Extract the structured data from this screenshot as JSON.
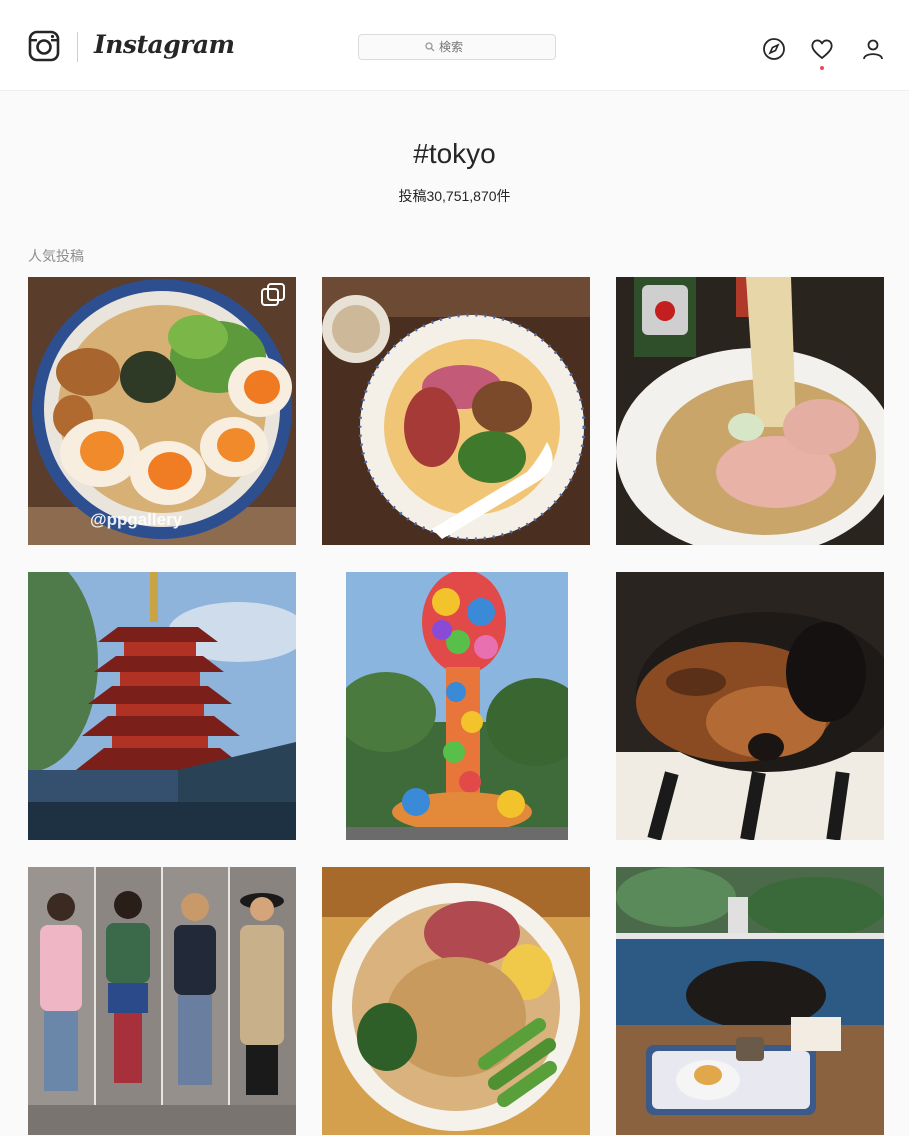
{
  "header": {
    "wordmark": "Instagram",
    "search_placeholder": "検索",
    "icons": [
      "instagram-camera-icon",
      "compass-icon",
      "heart-icon",
      "person-icon"
    ]
  },
  "hashtag": {
    "title": "#tokyo",
    "post_count": "投稿30,751,870件"
  },
  "section": {
    "label": "人気投稿"
  },
  "posts": [
    {
      "subject": "ramen-with-eggs",
      "watermark": "@ppgallery",
      "multi": true
    },
    {
      "subject": "mazesoba-bowl"
    },
    {
      "subject": "shoyu-ramen-noodles"
    },
    {
      "subject": "five-story-pagoda"
    },
    {
      "subject": "colorful-balloon-sculpture"
    },
    {
      "subject": "sleeping-dachshund"
    },
    {
      "subject": "four-fashion-outfits"
    },
    {
      "subject": "tsukemen-bowl"
    },
    {
      "subject": "cafe-table-dessert"
    }
  ],
  "colors": {
    "accent": "#ed4956",
    "text": "#262626",
    "muted": "#8e8e8e",
    "background": "#fafafa"
  }
}
